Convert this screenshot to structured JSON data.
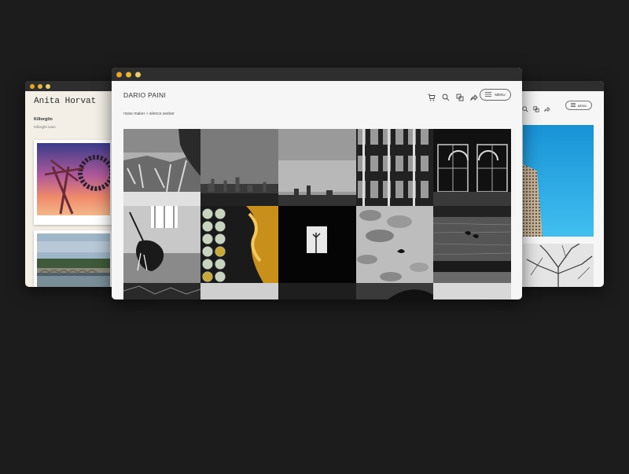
{
  "left_window": {
    "site_name": "Anita Horvat",
    "location": "Killorglin",
    "caption": "Killorglin town"
  },
  "center_window": {
    "site_name": "DARIO PAINI",
    "tagline": "noise maker + silence seeker",
    "menu_label": "MENU",
    "icons": [
      "cart-icon",
      "search-icon",
      "tags-icon",
      "share-icon",
      "menu-icon"
    ]
  },
  "right_window": {
    "menu_label": "MENU",
    "icons": [
      "search-icon",
      "tags-icon",
      "share-icon",
      "menu-icon"
    ]
  },
  "colors": {
    "background": "#1c1c1c",
    "titlebar": "#2e2e2e",
    "dot_1": "#e8a524",
    "dot_2": "#e8b634",
    "dot_3": "#eccb6a",
    "sky_blue": "#1fa4e0"
  }
}
